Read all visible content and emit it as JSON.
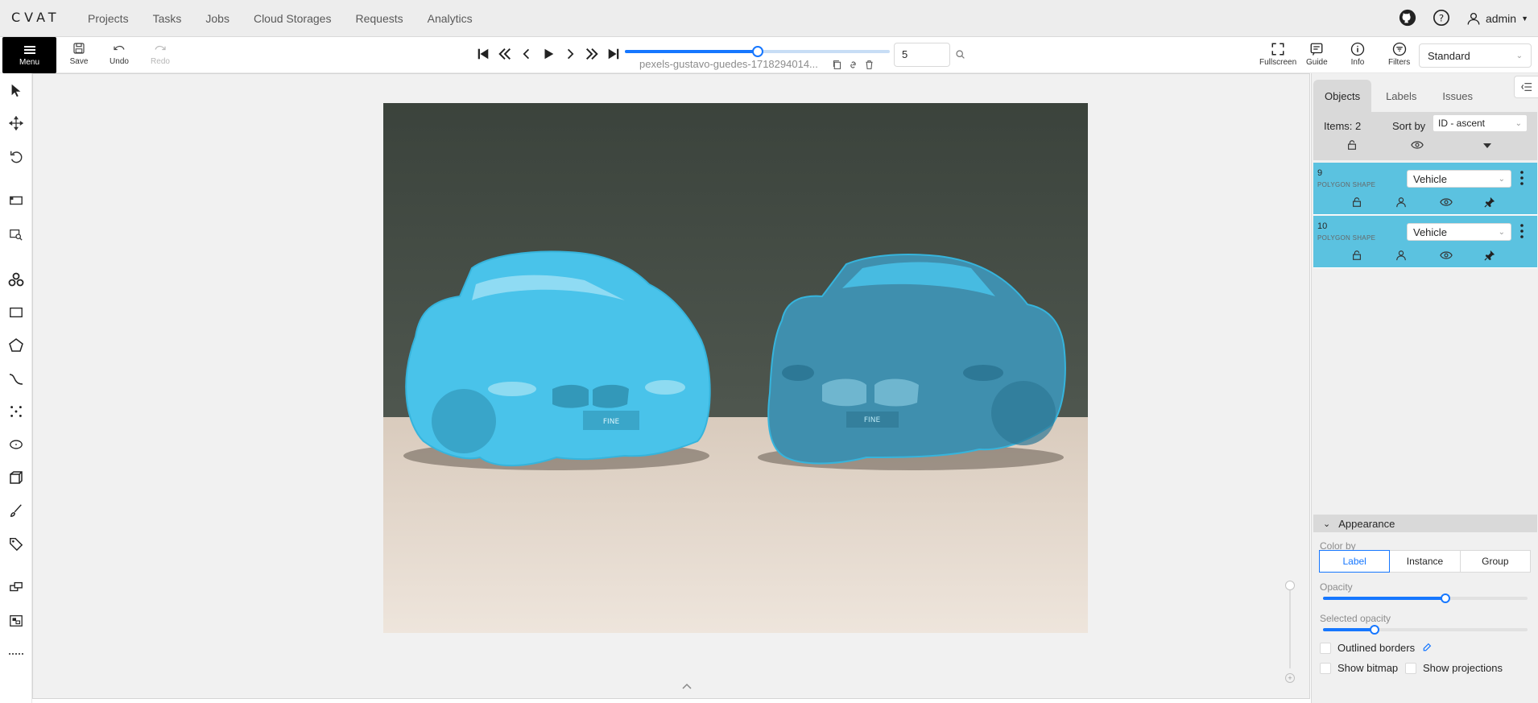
{
  "app": {
    "logo": "CVAT"
  },
  "nav": {
    "items": [
      "Projects",
      "Tasks",
      "Jobs",
      "Cloud Storages",
      "Requests",
      "Analytics"
    ],
    "user": "admin"
  },
  "toolbar": {
    "menu_label": "Menu",
    "save_label": "Save",
    "undo_label": "Undo",
    "redo_label": "Redo",
    "filename": "pexels-gustavo-guedes-1718294014...",
    "frame_value": "5",
    "frame_slider_fraction": 0.5,
    "fullscreen_label": "Fullscreen",
    "guide_label": "Guide",
    "info_label": "Info",
    "filters_label": "Filters",
    "workspace": "Standard"
  },
  "sidebar": {
    "tabs": [
      "Objects",
      "Labels",
      "Issues"
    ],
    "items_count": "Items: 2",
    "sort_label": "Sort by",
    "sort_value": "ID - ascent",
    "objects": [
      {
        "id": "9",
        "type": "POLYGON SHAPE",
        "label": "Vehicle",
        "color": "#5bc2e0"
      },
      {
        "id": "10",
        "type": "POLYGON SHAPE",
        "label": "Vehicle",
        "color": "#5bc2e0"
      }
    ],
    "appearance": {
      "title": "Appearance",
      "color_by_label": "Color by",
      "color_by_options": [
        "Label",
        "Instance",
        "Group"
      ],
      "color_by_selected": "Label",
      "opacity_label": "Opacity",
      "opacity_value": 0.6,
      "selected_opacity_label": "Selected opacity",
      "selected_opacity_value": 0.25,
      "outlined_borders_label": "Outlined borders",
      "show_bitmap_label": "Show bitmap",
      "show_projections_label": "Show projections"
    }
  },
  "colors": {
    "accent": "#1677ff",
    "annotation": "#49c3ea"
  }
}
